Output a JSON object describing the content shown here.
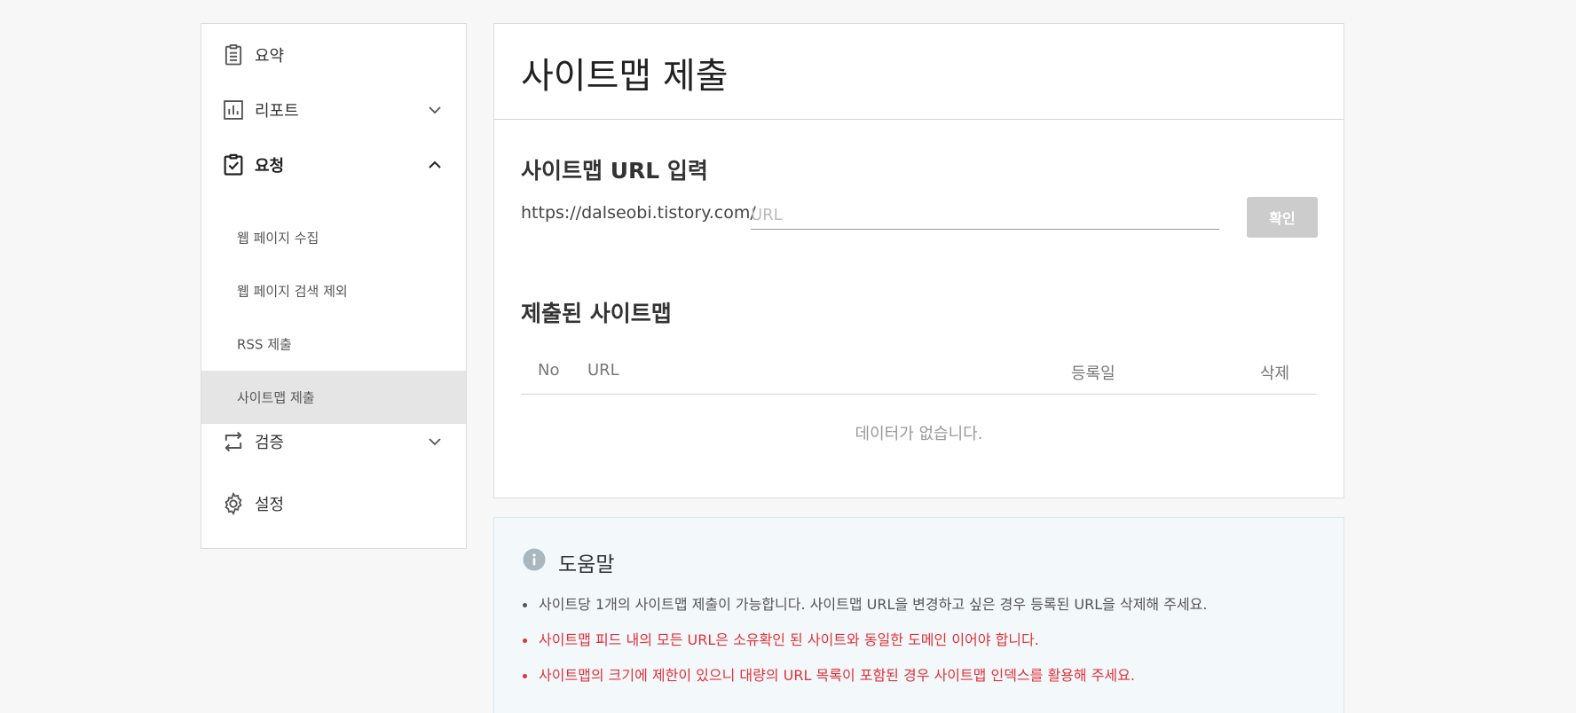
{
  "sidebar": {
    "items": [
      {
        "label": "요약",
        "icon": "clipboard-list-icon"
      },
      {
        "label": "리포트",
        "icon": "bar-chart-icon"
      },
      {
        "label": "요청",
        "icon": "clipboard-check-icon"
      },
      {
        "label": "검증",
        "icon": "repeat-icon"
      },
      {
        "label": "설정",
        "icon": "gear-icon"
      }
    ],
    "request_sub": [
      {
        "label": "웹 페이지 수집"
      },
      {
        "label": "웹 페이지 검색 제외"
      },
      {
        "label": "RSS 제출"
      },
      {
        "label": "사이트맵 제출",
        "selected": true
      }
    ]
  },
  "main": {
    "title": "사이트맵 제출",
    "input_section": {
      "title": "사이트맵 URL 입력",
      "url_prefix": "https://dalseobi.tistory.com/",
      "placeholder": "URL",
      "value": "",
      "confirm_label": "확인"
    },
    "submitted_section": {
      "title": "제출된 사이트맵",
      "columns": [
        "No",
        "URL",
        "등록일",
        "삭제"
      ],
      "rows": [],
      "empty_message": "데이터가 없습니다."
    }
  },
  "help": {
    "title": "도움말",
    "items": [
      {
        "text": "사이트당 1개의 사이트맵 제출이 가능합니다. 사이트맵 URL을 변경하고 싶은 경우 등록된 URL을 삭제해 주세요.",
        "color": "#555555"
      },
      {
        "text": "사이트맵 피드 내의 모든 URL은 소유확인 된 사이트와 동일한 도메인 이어야 합니다.",
        "color": "#e0323a"
      },
      {
        "text": "사이트맵의 크기에 제한이 있으니 대량의 URL 목록이 포함된 경우 사이트맵 인덱스를 활용해 주세요.",
        "color": "#e0323a"
      }
    ]
  },
  "colors": {
    "background": "#f7f7f7",
    "selected_bg": "#e5e5e5",
    "button_disabled": "#cccccc",
    "help_bg": "#f3f8fa",
    "warning_text": "#e0323a"
  }
}
